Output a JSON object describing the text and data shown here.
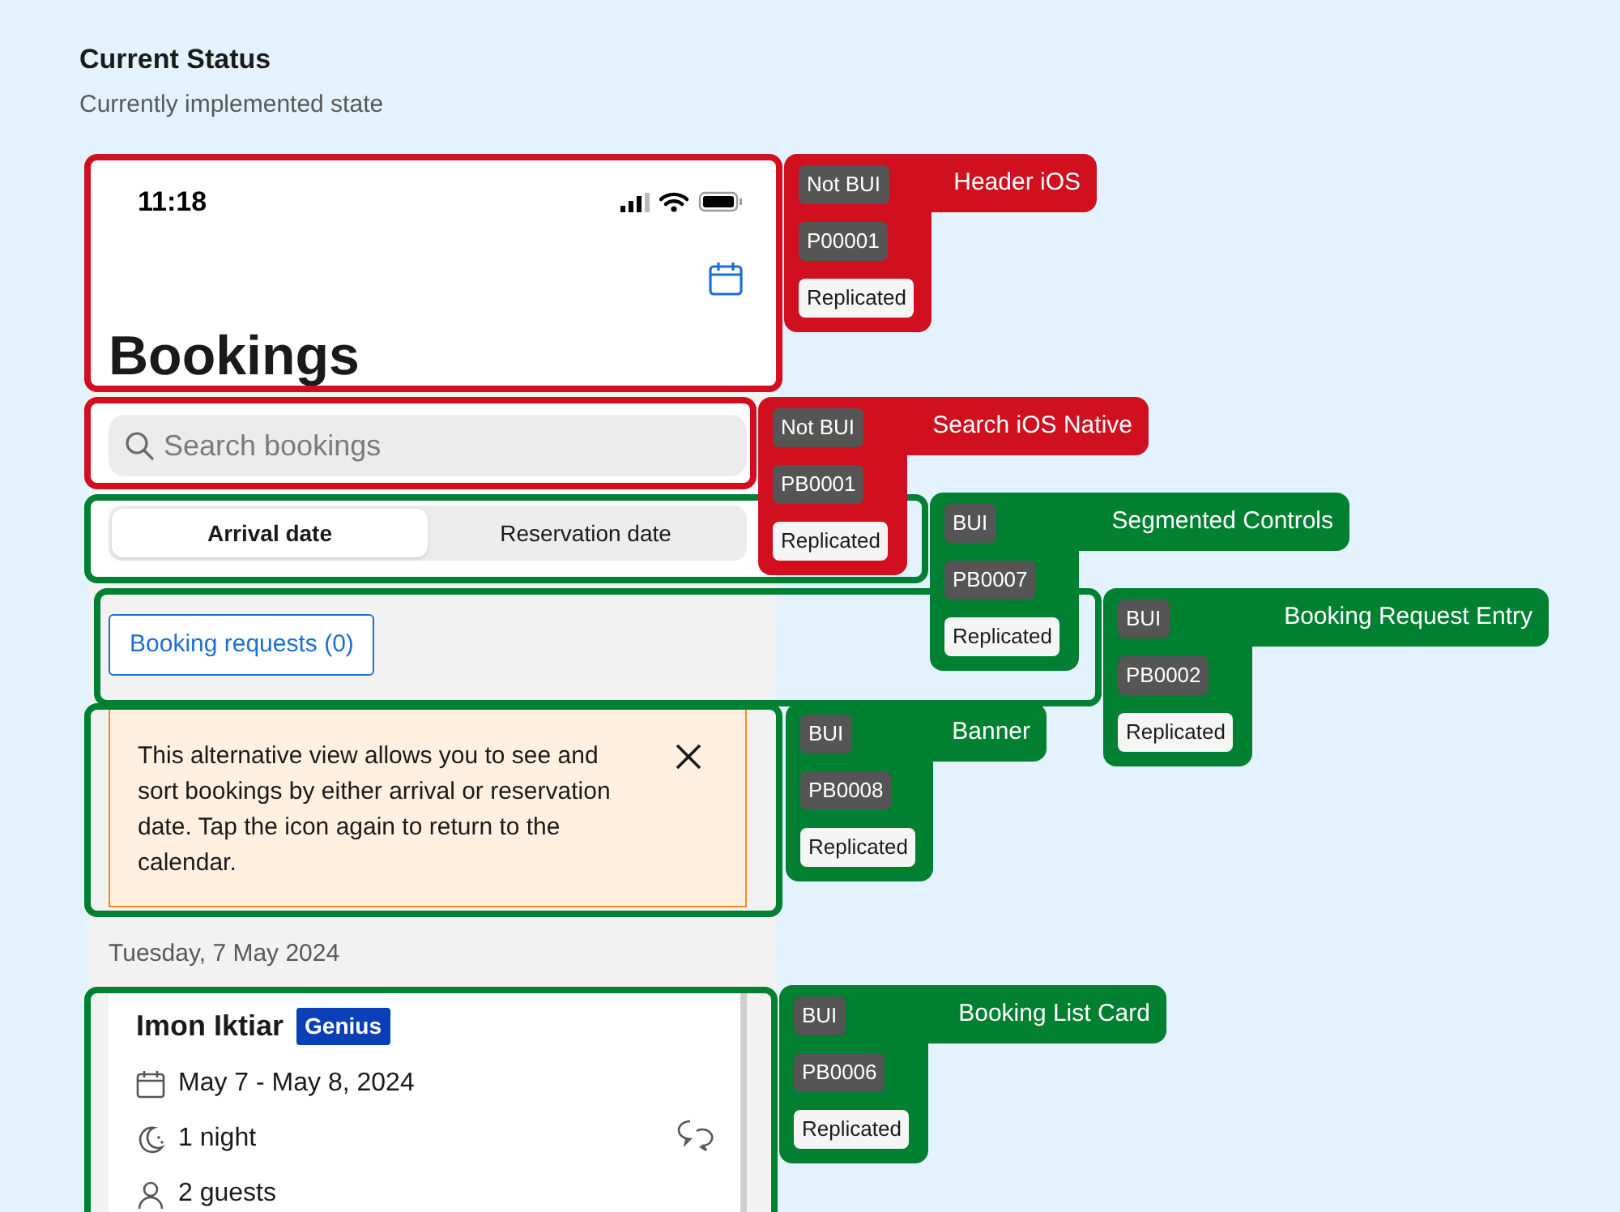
{
  "page": {
    "title": "Current Status",
    "subtitle": "Currently implemented state"
  },
  "phone": {
    "status_bar": {
      "time": "11:18"
    },
    "title": "Bookings",
    "search": {
      "placeholder": "Search bookings"
    },
    "segments": [
      {
        "label": "Arrival date",
        "selected": true
      },
      {
        "label": "Reservation date",
        "selected": false
      }
    ],
    "booking_requests_button": "Booking requests (0)",
    "banner": {
      "text": "This alternative view allows you to see and sort bookings by either arrival or reservation date. Tap the icon again to return to the calendar."
    },
    "date_header": "Tuesday, 7 May 2024",
    "booking_card": {
      "guest_name": "Imon Iktiar",
      "badge": "Genius",
      "dates": "May 7 - May 8, 2024",
      "nights": "1 night",
      "guests": "2 guests"
    }
  },
  "annotations": [
    {
      "title": "Header iOS",
      "tag": "Not BUI",
      "code": "P00001",
      "status": "Replicated",
      "color": "#d0101e"
    },
    {
      "title": "Search iOS Native",
      "tag": "Not BUI",
      "code": "PB0001",
      "status": "Replicated",
      "color": "#d0101e"
    },
    {
      "title": "Segmented Controls",
      "tag": "BUI",
      "code": "PB0007",
      "status": "Replicated",
      "color": "#008030"
    },
    {
      "title": "Booking Request Entry",
      "tag": "BUI",
      "code": "PB0002",
      "status": "Replicated",
      "color": "#008030"
    },
    {
      "title": "Banner",
      "tag": "BUI",
      "code": "PB0008",
      "status": "Replicated",
      "color": "#008030"
    },
    {
      "title": "Booking List Card",
      "tag": "BUI",
      "code": "PB0006",
      "status": "Replicated",
      "color": "#008030"
    }
  ]
}
